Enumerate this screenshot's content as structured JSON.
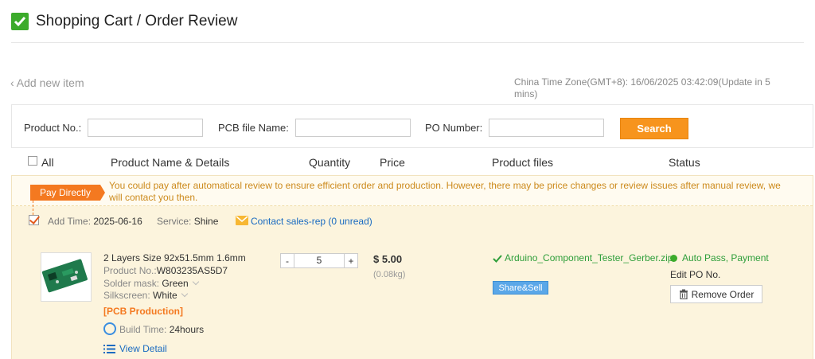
{
  "header": {
    "title": "Shopping Cart / Order Review",
    "icon": "check-square-icon"
  },
  "toolbar": {
    "add_new": "Add new item",
    "timezone": "China Time Zone(GMT+8):  16/06/2025 03:42:09(Update in 5 mins)"
  },
  "search": {
    "product_no_label": "Product No.:",
    "product_no_value": "",
    "pcb_file_label": "PCB file Name:",
    "pcb_file_value": "",
    "po_label": "PO Number:",
    "po_value": "",
    "button": "Search",
    "accent": "#f7941d"
  },
  "table": {
    "headers": [
      "All",
      "Product Name & Details",
      "Quantity",
      "Price",
      "Product files",
      "Status"
    ]
  },
  "order": {
    "pay_tag": "Pay Directly",
    "notice": "You could pay after automatical review to ensure efficient order and production. However, there may be price changes or review issues after manual review, we will contact you then.",
    "add_time_label": "Add Time:",
    "add_time": "2025-06-16",
    "service_label": "Service:",
    "service": "Shine",
    "contact": "Contact sales-rep (0 unread)",
    "product": {
      "name": "2 Layers Size 92x51.5mm 1.6mm",
      "product_no_label": "Product No.:",
      "product_no": "W803235AS5D7",
      "solder_label": "Solder mask:",
      "solder": "Green",
      "silk_label": "Silkscreen:",
      "silk": "White",
      "category": "[PCB Production]",
      "build_label": "Build Time:",
      "build": "24hours",
      "view_detail": "View Detail"
    },
    "quantity": "5",
    "price": "$ 5.00",
    "weight": "(0.08kg)",
    "file": "Arduino_Component_Tester_Gerber.zip",
    "share": "Share&Sell",
    "status": "Auto Pass, Payment",
    "edit_po": "Edit PO No.",
    "remove": "Remove Order",
    "colors": {
      "status": "#3cab2b",
      "link": "#1a6bc1",
      "tag": "#f47920"
    }
  }
}
